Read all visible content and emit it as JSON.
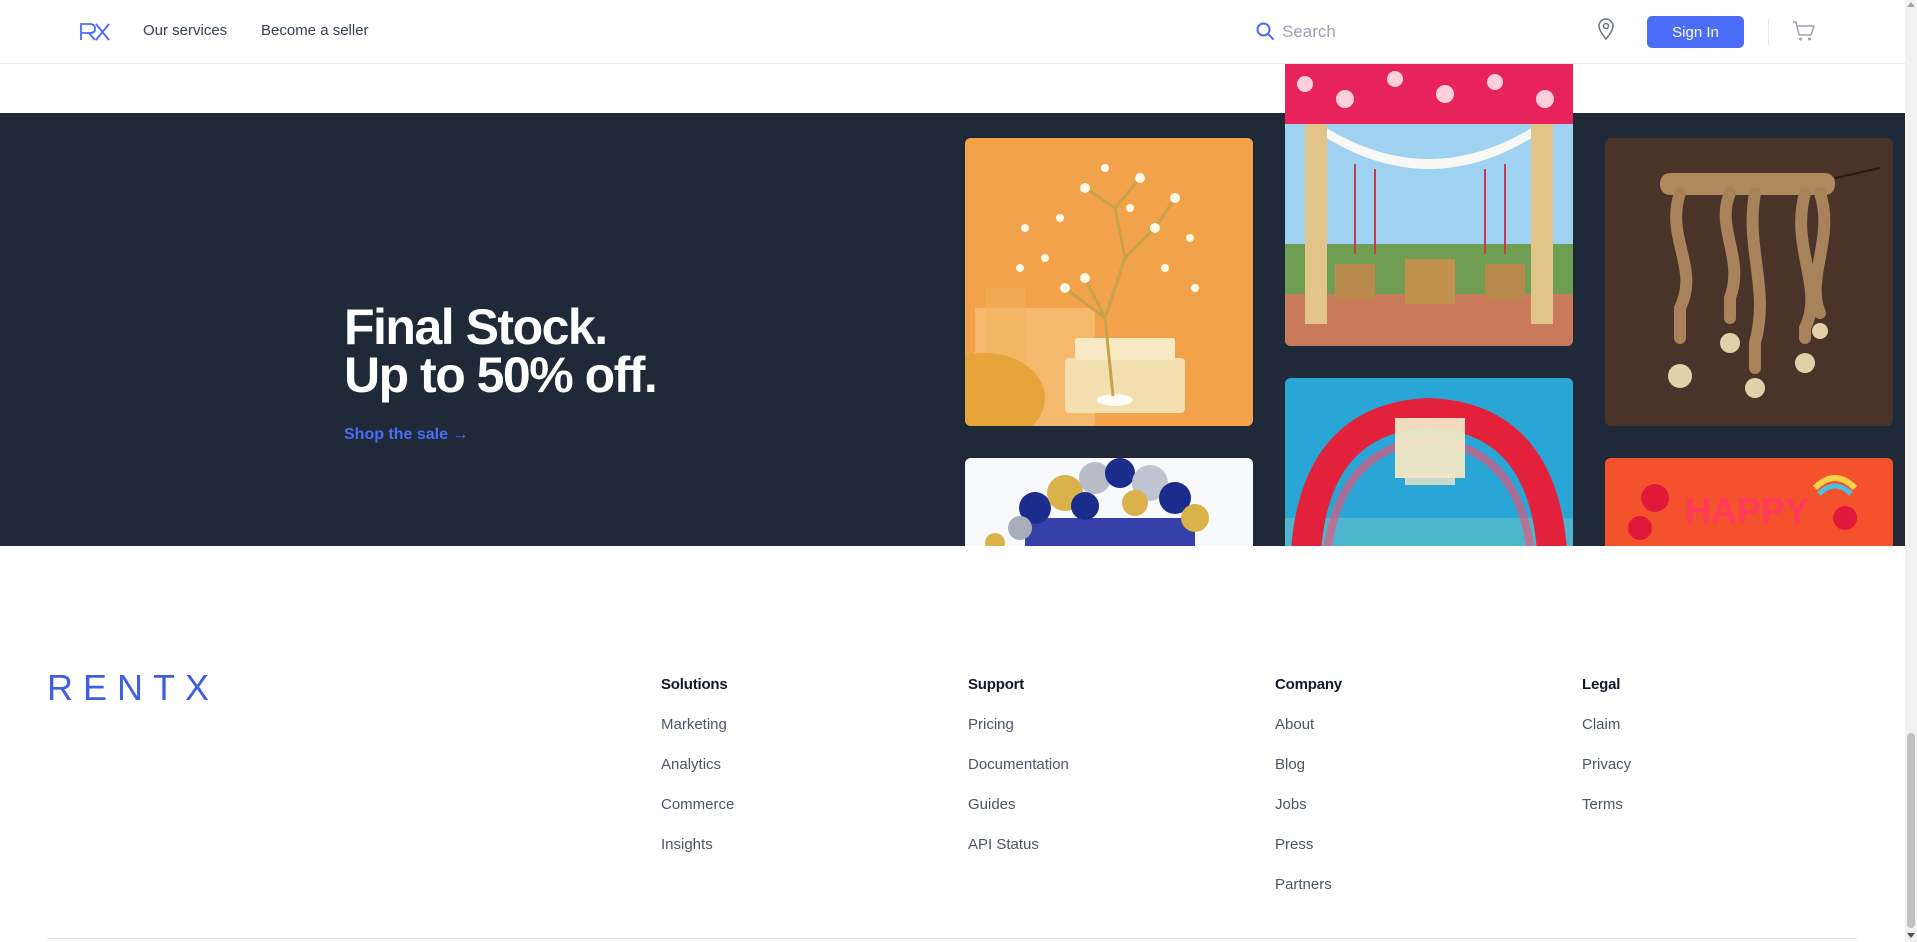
{
  "header": {
    "logo_alt": "RX",
    "nav": [
      "Our services",
      "Become a seller"
    ],
    "search_placeholder": "Search",
    "signin_label": "Sign In"
  },
  "hero": {
    "title_line1": "Final Stock.",
    "title_line2": "Up to 50% off.",
    "link_label": "Shop the sale →",
    "tiles": [
      "tree-lamp",
      "balloon-garland",
      "wedding-mandap",
      "floral-arch",
      "rope-pendant-lamp",
      "happy-birthday-balloons"
    ]
  },
  "footer": {
    "brand": "RENTX",
    "columns": [
      {
        "title": "Solutions",
        "links": [
          "Marketing",
          "Analytics",
          "Commerce",
          "Insights"
        ]
      },
      {
        "title": "Support",
        "links": [
          "Pricing",
          "Documentation",
          "Guides",
          "API Status"
        ]
      },
      {
        "title": "Company",
        "links": [
          "About",
          "Blog",
          "Jobs",
          "Press",
          "Partners"
        ]
      },
      {
        "title": "Legal",
        "links": [
          "Claim",
          "Privacy",
          "Terms"
        ]
      }
    ]
  },
  "colors": {
    "accent": "#4a6cf7",
    "hero_bg": "#1f2937",
    "text": "#374151"
  }
}
